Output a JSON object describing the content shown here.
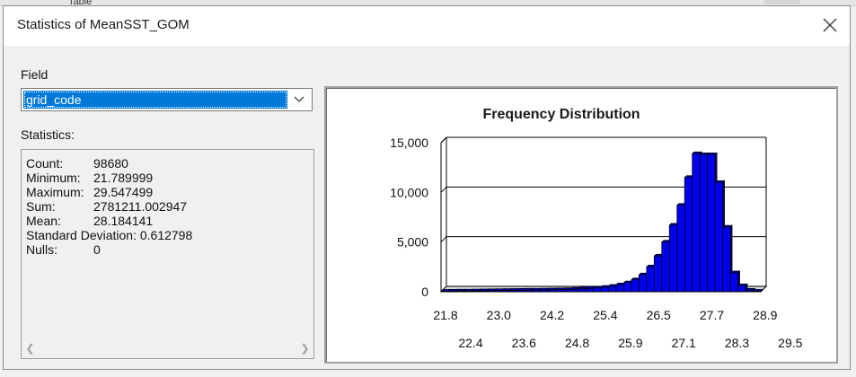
{
  "window": {
    "title": "Statistics of MeanSST_GOM",
    "behind_text": "Table"
  },
  "field": {
    "label": "Field",
    "selected": "grid_code"
  },
  "statistics": {
    "label": "Statistics:",
    "rows": [
      {
        "key": "Count:",
        "value": "98680"
      },
      {
        "key": "Minimum:",
        "value": "21.789999"
      },
      {
        "key": "Maximum:",
        "value": "29.547499"
      },
      {
        "key": "Sum:",
        "value": "2781211.002947"
      },
      {
        "key": "Mean:",
        "value": "28.184141"
      },
      {
        "key": "Standard Deviation:",
        "value": "0.612798"
      },
      {
        "key": "Nulls:",
        "value": "0"
      }
    ]
  },
  "icons": {
    "close": "close-icon",
    "dropdown": "chevron-down-icon",
    "scroll_left": "chevron-left-icon",
    "scroll_right": "chevron-right-icon"
  },
  "colors": {
    "selection": "#0078d7",
    "bar_fill": "#0000ee",
    "bar_stroke": "#000000"
  },
  "chart_data": {
    "type": "bar",
    "title": "Frequency Distribution",
    "xlabel": "",
    "ylabel": "",
    "ylim": [
      0,
      15000
    ],
    "y_ticks": [
      "15,000",
      "10,000",
      "5,000",
      "0"
    ],
    "y_tick_values": [
      15000,
      10000,
      5000,
      0
    ],
    "x_ticks_top": [
      "21.8",
      "23.0",
      "24.2",
      "25.4",
      "26.5",
      "27.7",
      "28.9"
    ],
    "x_ticks_bottom": [
      "22.4",
      "23.6",
      "24.8",
      "25.9",
      "27.1",
      "28.3",
      "29.5"
    ],
    "grid": true,
    "style": "3d",
    "values": [
      50,
      60,
      70,
      80,
      90,
      100,
      110,
      120,
      130,
      140,
      150,
      160,
      170,
      180,
      190,
      200,
      220,
      250,
      280,
      320,
      380,
      450,
      550,
      700,
      900,
      1200,
      1700,
      2500,
      3600,
      5000,
      6700,
      8700,
      11500,
      13900,
      13800,
      13800,
      11000,
      6500,
      1900,
      600,
      150,
      50
    ]
  }
}
